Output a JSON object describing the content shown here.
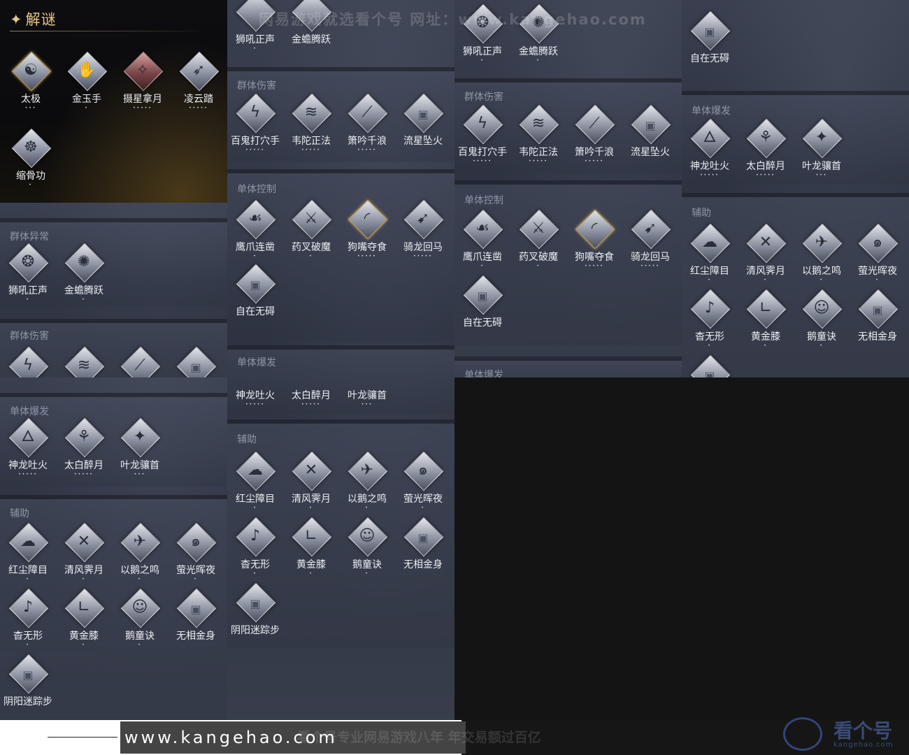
{
  "watermark_top": "网易游戏就选看个号  网址：www.kangehao.com",
  "puzzle": {
    "title": "解谜",
    "skills": [
      {
        "label": "太极",
        "stars": "•••"
      },
      {
        "label": "金玉手",
        "stars": "•"
      },
      {
        "label": "摄星拿月",
        "stars": "•••••"
      },
      {
        "label": "凌云踏",
        "stars": "•••••"
      },
      {
        "label": "缩骨功",
        "stars": "•"
      }
    ]
  },
  "col1": {
    "sec_group_abnormal": "群体异常",
    "lion": "狮吼正声",
    "toad": "金蟾腾跃",
    "sec_group_damage": "群体伤害",
    "sec_single_burst": "单体爆发",
    "dragon": "神龙吐火",
    "libai": "太白醉月",
    "yelong": "叶龙骧首",
    "sec_assist": "辅助",
    "hongchen": "红尘障目",
    "qingfeng": "清风霁月",
    "yie": "以鹅之鸣",
    "yingguang": "萤光晖夜",
    "xingwu": "杳无形",
    "huangjin": "黄金膝",
    "etong": "鹅童诀",
    "wuxiang": "无相金身",
    "yinyang": "阴阳迷踪步"
  },
  "col2": {
    "lion": "狮吼正声",
    "toad": "金蟾腾跃",
    "sec_group_damage": "群体伤害",
    "baigui": "百鬼打穴手",
    "weituo": "韦陀正法",
    "xiaoyin": "箫吟千浪",
    "liuxing": "流星坠火",
    "sec_single_control": "单体控制",
    "yingzhao": "鹰爪连凿",
    "yaocha": "药叉破魔",
    "gouzui": "狗嘴夺食",
    "qilong": "骑龙回马",
    "zizai": "自在无碍",
    "sec_single_burst": "单体爆发",
    "dragon": "神龙吐火",
    "libai": "太白醉月",
    "yelong": "叶龙骧首",
    "sec_assist": "辅助",
    "hongchen": "红尘障目",
    "qingfeng": "清风霁月",
    "yie": "以鹅之鸣",
    "yingguang": "萤光晖夜",
    "xingwu": "杳无形",
    "huangjin": "黄金膝",
    "etong": "鹅童诀",
    "wuxiang": "无相金身",
    "yinyang": "阴阳迷踪步"
  },
  "col3": {
    "lion": "狮吼正声",
    "toad": "金蟾腾跃",
    "sec_group_damage": "群体伤害",
    "baigui": "百鬼打穴手",
    "weituo": "韦陀正法",
    "xiaoyin": "箫吟千浪",
    "liuxing": "流星坠火",
    "sec_single_control": "单体控制",
    "yingzhao": "鹰爪连凿",
    "yaocha": "药叉破魔",
    "gouzui": "狗嘴夺食",
    "qilong": "骑龙回马",
    "zizai": "自在无碍",
    "sec_single_burst": "单体爆发"
  },
  "col4": {
    "zizai": "自在无碍",
    "sec_single_burst": "单体爆发",
    "dragon": "神龙吐火",
    "libai": "太白醉月",
    "yelong": "叶龙骧首",
    "sec_assist": "辅助",
    "hongchen": "红尘障目",
    "qingfeng": "清风霁月",
    "yie": "以鹅之鸣",
    "yingguang": "萤光晖夜",
    "xingwu": "杳无形",
    "huangjin": "黄金膝",
    "etong": "鹅童诀",
    "wuxiang": "无相金身"
  },
  "stars": {
    "one": "•",
    "three": "•••",
    "five": "•••••"
  },
  "bottom": {
    "url": "www.kangehao.com",
    "slogan": "看个号专业网易游戏八年  年交易额过百亿",
    "logo_text": "看个号",
    "logo_sub": "kangehao.com"
  }
}
